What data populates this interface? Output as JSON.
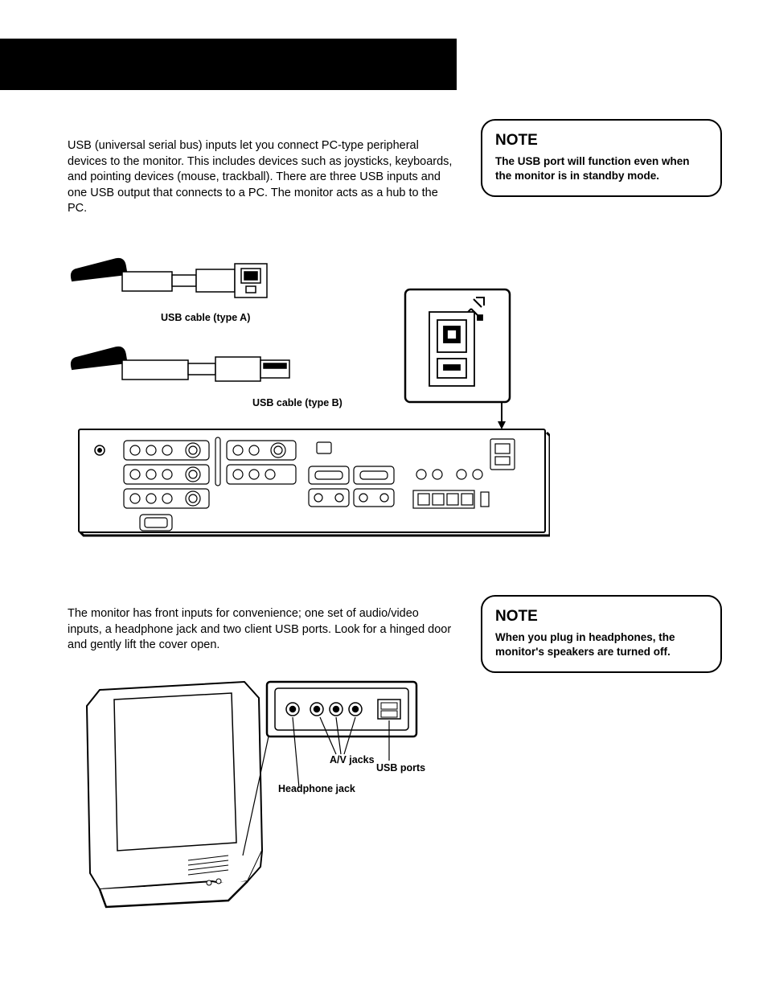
{
  "intro1": "USB (universal serial bus) inputs let you connect PC-type peripheral devices to the monitor. This includes devices such as joysticks, keyboards, and pointing devices (mouse, trackball). There are three USB inputs and one USB output that connects to a PC. The monitor acts as a hub to the PC.",
  "note1": {
    "title": "NOTE",
    "body": "The USB port will function even when the monitor is in standby mode."
  },
  "diagram1": {
    "cable_a_label": "USB cable (type A)",
    "cable_b_label": "USB cable (type B)"
  },
  "intro2": "The monitor has front inputs for convenience; one set of audio/video inputs, a headphone jack and two client USB ports. Look for a hinged door and gently lift the cover open.",
  "note2": {
    "title": "NOTE",
    "body": "When you plug in headphones, the monitor's speakers are turned off."
  },
  "diagram2": {
    "headphone_label": "Headphone jack",
    "av_label": "A/V jacks",
    "usb_label": "USB ports"
  }
}
